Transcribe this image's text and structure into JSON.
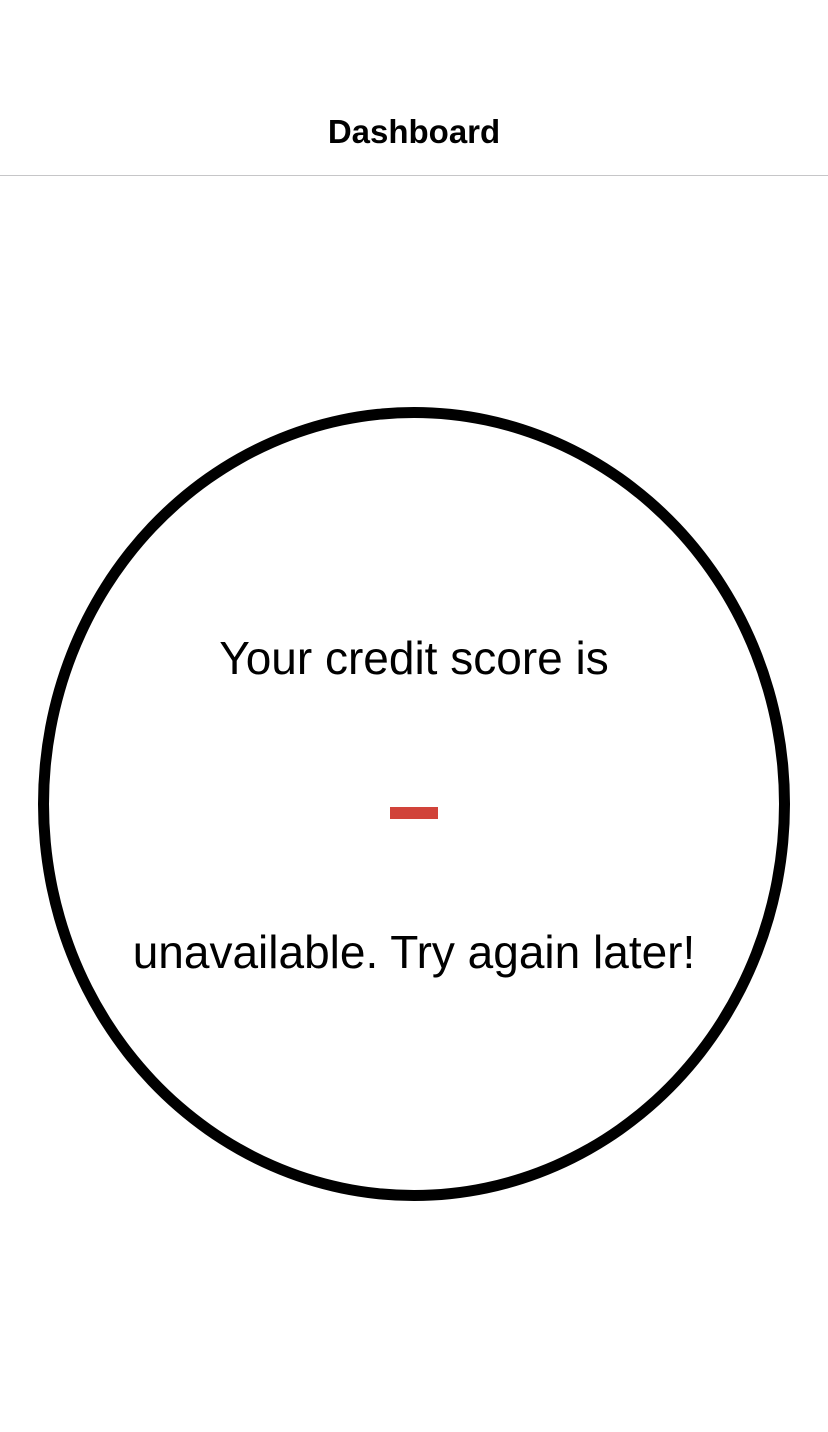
{
  "nav": {
    "title": "Dashboard"
  },
  "credit_score": {
    "heading": "Your credit score is",
    "value_placeholder": "–",
    "message": "unavailable. Try again later!",
    "accent_color": "#d1433a",
    "ring_color": "#000000"
  }
}
